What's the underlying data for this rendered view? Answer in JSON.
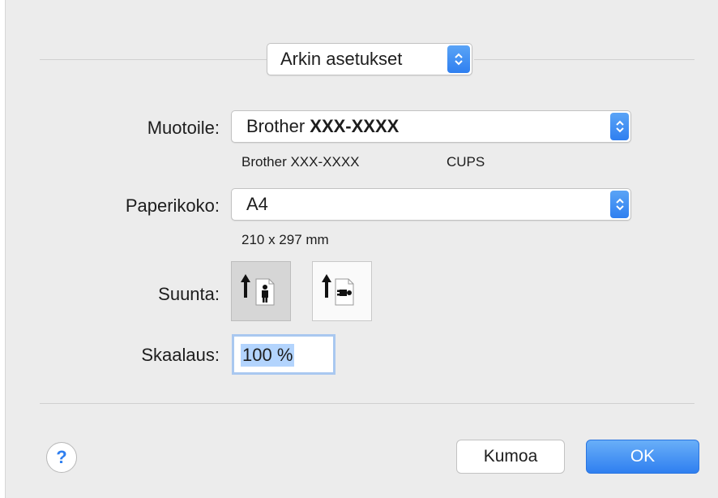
{
  "header_popup": {
    "label": "Arkin asetukset"
  },
  "format_for": {
    "label": "Muotoile:",
    "value_prefix": "Brother",
    "value_model": "XXX-XXXX",
    "info_model": "Brother XXX-XXXX",
    "info_driver": "CUPS"
  },
  "paper_size": {
    "label": "Paperikoko:",
    "value": "A4",
    "info": "210 x 297 mm"
  },
  "orientation": {
    "label": "Suunta:",
    "options": [
      {
        "name": "portrait",
        "selected": true
      },
      {
        "name": "landscape",
        "selected": false
      }
    ]
  },
  "scale": {
    "label": "Skaalaus:",
    "value": "100 %"
  },
  "buttons": {
    "help": "?",
    "cancel": "Kumoa",
    "ok": "OK"
  },
  "colors": {
    "accent": "#2f7ff0",
    "dialog_bg": "#ececec"
  }
}
